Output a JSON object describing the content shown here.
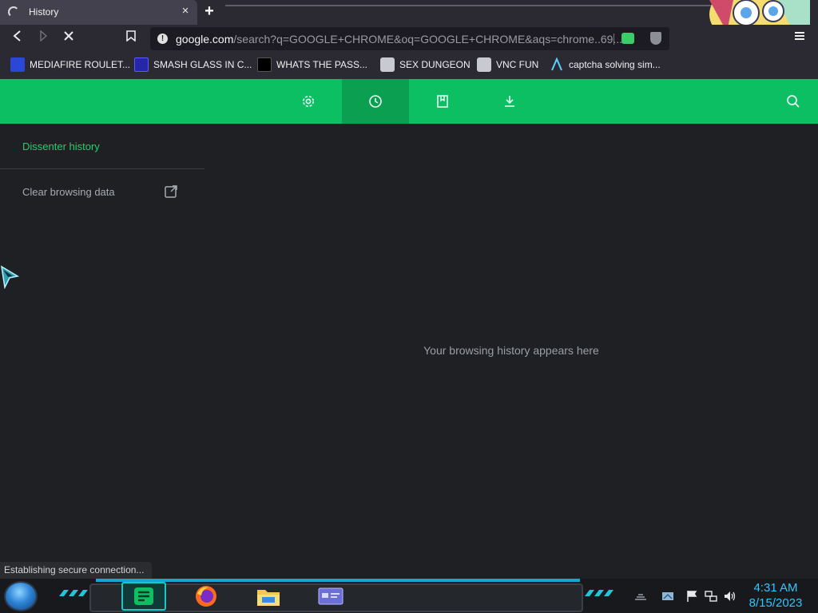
{
  "browser": {
    "tab": {
      "title": "History",
      "close_label": "×"
    },
    "new_tab_label": "+",
    "address": {
      "host": "google.com",
      "path": "/search?q=GOOGLE+CHROME&oq=GOOGLE+CHROME&aqs=chrome..69..."
    },
    "bookmarks": [
      {
        "label": "MEDIAFIRE ROULET...",
        "icon": "mediafire-icon",
        "color": "#2a47d8"
      },
      {
        "label": "SMASH GLASS IN C...",
        "icon": "chevron-right-icon",
        "color": "#3b3bff"
      },
      {
        "label": "WHATS THE PASS...",
        "icon": "pixel-icon",
        "color": "#000000"
      },
      {
        "label": "SEX DUNGEON",
        "icon": "cube-icon",
        "color": "#c9c9d2"
      },
      {
        "label": "VNC FUN",
        "icon": "cube-icon",
        "color": "#c9c9d2"
      },
      {
        "label": "captcha solving sim...",
        "icon": "lambda-icon",
        "color": "#5ad2ff"
      }
    ]
  },
  "page": {
    "accent": "#0dbf63",
    "sidebar": {
      "history_link": "Dissenter history",
      "clear_data": "Clear browsing data"
    },
    "empty_message": "Your browsing history appears here"
  },
  "status_text": "Establishing secure connection...",
  "clock": {
    "time": "4:31 AM",
    "date": "8/15/2023"
  }
}
